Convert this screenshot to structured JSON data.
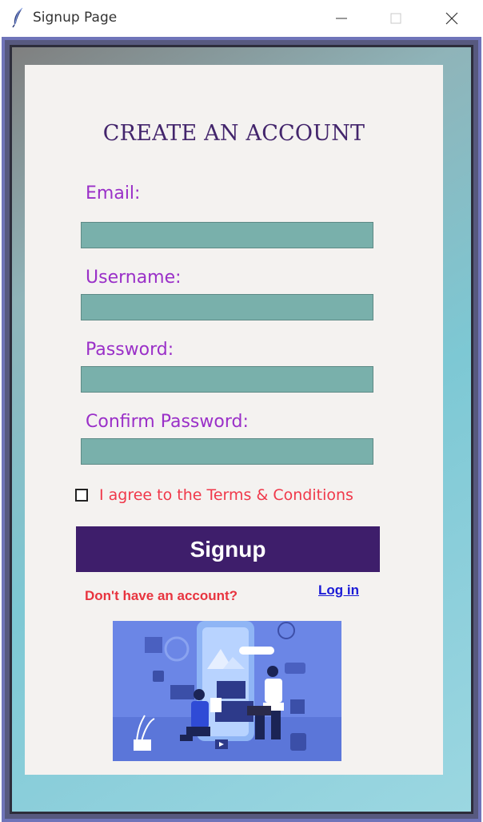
{
  "window": {
    "title": "Signup Page"
  },
  "colors": {
    "accent": "#3e1e6b",
    "label": "#9a30c8",
    "input_fill": "#79b0ab",
    "error_text": "#e8343f",
    "link": "#1a1ad6"
  },
  "form": {
    "heading": "CREATE AN ACCOUNT",
    "email": {
      "label": "Email:",
      "value": ""
    },
    "username": {
      "label": "Username:",
      "value": ""
    },
    "password": {
      "label": "Password:",
      "value": ""
    },
    "confirm_password": {
      "label": "Confirm Password:",
      "value": ""
    },
    "terms": {
      "label": "I agree to the Terms & Conditions",
      "checked": false
    },
    "signup_label": "Signup",
    "no_account_text": "Don't have an account?",
    "login_label": "Log in"
  },
  "icons": {
    "app": "feather-icon",
    "minimize": "minimize-icon",
    "maximize": "maximize-icon",
    "close": "close-icon",
    "illustration": "people-with-phone-illustration"
  }
}
